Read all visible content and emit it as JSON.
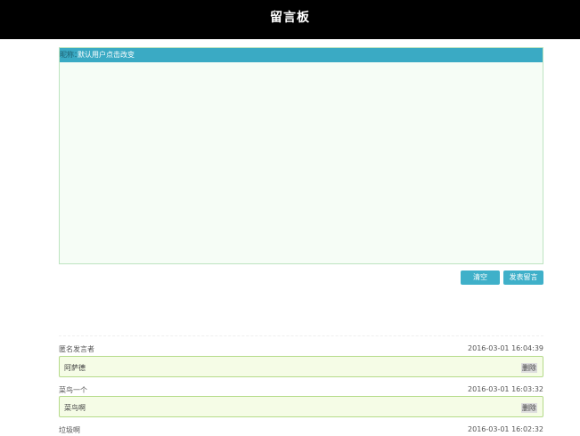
{
  "header": {
    "title": "留言板"
  },
  "composer": {
    "name_label": "昵称：",
    "name_placeholder": "默认用户点击改变",
    "message_value": ""
  },
  "buttons": {
    "clear_label": "清空",
    "post_label": "发表留言"
  },
  "messages": [
    {
      "author": "匿名发言者",
      "time": "2016-03-01 16:04:39",
      "content": "阿萨德",
      "delete_label": "删除"
    },
    {
      "author": "菜鸟一个",
      "time": "2016-03-01 16:03:32",
      "content": "菜鸟啊",
      "delete_label": "删除"
    },
    {
      "author": "垃圾啊",
      "time": "2016-03-01 16:02:32"
    }
  ],
  "colors": {
    "header_bg": "#000000",
    "name_bar": "#3aaac4",
    "button": "#3fb0c9",
    "composer_bg": "#f6fdf6",
    "message_bg": "#f5fce6",
    "message_border": "#b5db8a"
  }
}
